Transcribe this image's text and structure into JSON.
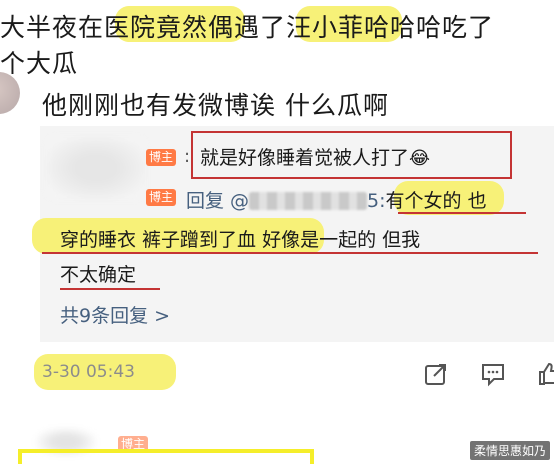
{
  "post": {
    "line1": "大半夜在医院竟然偶遇了汪小菲哈哈哈吃了",
    "line2": "个大瓜",
    "line3": "他刚刚也有发微博诶 什么瓜啊"
  },
  "comment": {
    "badge": "博主",
    "text": "就是好像睡着觉被人打了",
    "emoji": "😂"
  },
  "reply": {
    "badge": "博主",
    "prefix": "回复 @",
    "name_suffix": "5:",
    "part1": "有个女的 也",
    "part2": "穿的睡衣 裤子蹭到了血",
    "part3": " 好像是一起的 但我",
    "part4": "不太确定"
  },
  "more_replies": "共9条回复 >",
  "timestamp": "3-30 05:43",
  "bottom_badge": "博主",
  "watermark": "柔情思惠如乃",
  "colors": {
    "highlight": "#f7f178",
    "annotation_red": "#c43434",
    "badge_orange": "#ff7a45",
    "link_blue": "#46607f"
  },
  "icons": [
    "share-icon",
    "comment-icon",
    "like-icon"
  ]
}
